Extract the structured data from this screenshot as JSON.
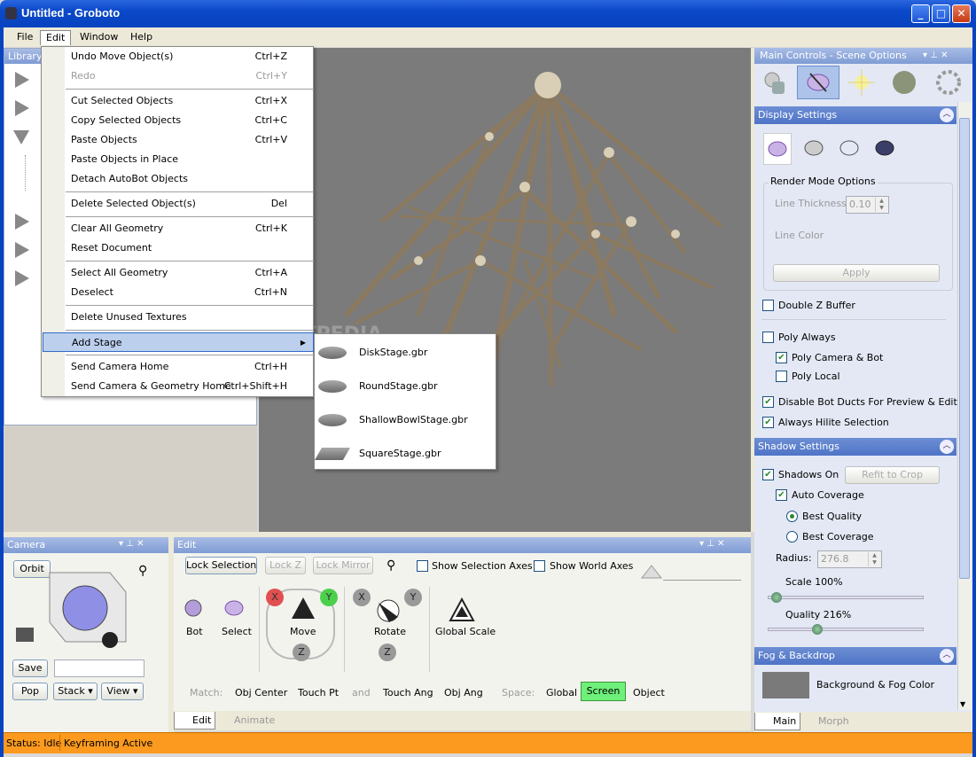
{
  "window": {
    "title": "Untitled - Groboto",
    "min": "_",
    "max": "□",
    "close": "✕"
  },
  "menubar": [
    "File",
    "Edit",
    "Window",
    "Help"
  ],
  "library": {
    "title": "Library"
  },
  "edit_menu": {
    "items": [
      {
        "label": "Undo Move Object(s)",
        "shortcut": "Ctrl+Z"
      },
      {
        "label": "Redo",
        "shortcut": "Ctrl+Y"
      },
      {
        "label": "Cut Selected Objects",
        "shortcut": "Ctrl+X"
      },
      {
        "label": "Copy Selected Objects",
        "shortcut": "Ctrl+C"
      },
      {
        "label": "Paste Objects",
        "shortcut": "Ctrl+V"
      },
      {
        "label": "Paste Objects in Place",
        "shortcut": ""
      },
      {
        "label": "Detach AutoBot Objects",
        "shortcut": ""
      },
      {
        "label": "Delete Selected Object(s)",
        "shortcut": "Del"
      },
      {
        "label": "Clear All Geometry",
        "shortcut": "Ctrl+K"
      },
      {
        "label": "Reset Document",
        "shortcut": ""
      },
      {
        "label": "Select All Geometry",
        "shortcut": "Ctrl+A"
      },
      {
        "label": "Deselect",
        "shortcut": "Ctrl+N"
      },
      {
        "label": "Delete Unused Textures",
        "shortcut": ""
      },
      {
        "label": "Add Stage",
        "shortcut": ""
      },
      {
        "label": "Send Camera Home",
        "shortcut": "Ctrl+H"
      },
      {
        "label": "Send Camera & Geometry Home",
        "shortcut": "Ctrl+Shift+H"
      }
    ],
    "submenu": [
      "DiskStage.gbr",
      "RoundStage.gbr",
      "ShallowBowlStage.gbr",
      "SquareStage.gbr"
    ]
  },
  "viewport": {
    "watermark": "SOFTPEDIA"
  },
  "right_panel": {
    "title": "Main Controls - Scene Options",
    "display": {
      "title": "Display Settings",
      "render_mode": "Render Mode Options",
      "line_thickness": "Line Thickness",
      "line_thickness_val": "0.10",
      "line_color": "Line Color",
      "apply": "Apply",
      "double_z": "Double Z Buffer",
      "poly_always": "Poly Always",
      "poly_camera": "Poly Camera & Bot",
      "poly_local": "Poly Local",
      "disable_ducts": "Disable Bot Ducts For Preview & Editing",
      "always_hilite": "Always Hilite Selection"
    },
    "shadow": {
      "title": "Shadow Settings",
      "shadows_on": "Shadows On",
      "refit": "Refit to Crop",
      "auto_coverage": "Auto Coverage",
      "best_quality": "Best Quality",
      "best_coverage": "Best Coverage",
      "radius": "Radius:",
      "radius_val": "276.8",
      "scale": "Scale 100%",
      "scale_level": 0.02,
      "quality": "Quality 216%",
      "quality_level": 0.3
    },
    "fog": {
      "title": "Fog & Backdrop",
      "bg_color": "Background & Fog Color"
    },
    "tabs": [
      "Main",
      "Morph"
    ]
  },
  "camera": {
    "title": "Camera",
    "orbit": "Orbit",
    "save": "Save",
    "pop": "Pop",
    "stack": "Stack",
    "view": "View"
  },
  "edit_panel": {
    "title": "Edit",
    "lock_selection": "Lock Selection",
    "lock_z": "Lock Z",
    "lock_mirror": "Lock Mirror",
    "show_sel_axes": "Show Selection Axes",
    "show_world_axes": "Show World Axes",
    "bot": "Bot",
    "select": "Select",
    "move": "Move",
    "rotate": "Rotate",
    "global_scale": "Global Scale",
    "axis_x": "X",
    "axis_y": "Y",
    "axis_z": "Z",
    "match": "Match:",
    "obj_center": "Obj Center",
    "touch_pt": "Touch Pt",
    "and": "and",
    "touch_ang": "Touch Ang",
    "obj_ang": "Obj Ang",
    "space": "Space:",
    "global": "Global",
    "screen": "Screen",
    "object": "Object",
    "tabs": [
      "Edit",
      "Animate"
    ]
  },
  "status": {
    "text": "Status: Idle",
    "keyframing": "Keyframing Active"
  },
  "colors": {
    "accent": "#316ac5",
    "status_bar": "#fb9a1e",
    "screen_selected": "#6ef07a"
  }
}
